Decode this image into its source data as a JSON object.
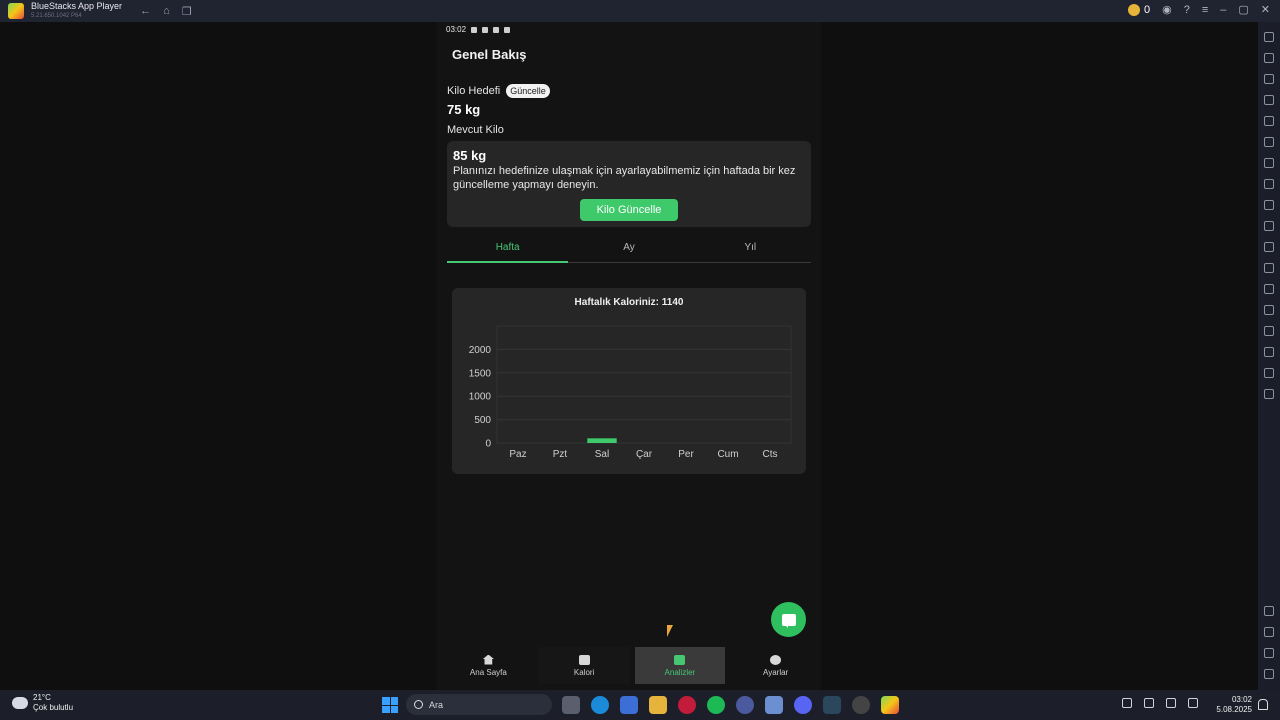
{
  "window": {
    "title": "BlueStacks App Player",
    "version": "5.21.650.1042 P64",
    "coins": "0"
  },
  "statusbar": {
    "time": "03:02"
  },
  "page": {
    "title": "Genel Bakış",
    "goal_label": "Kilo Hedefi",
    "goal_update_button": "Güncelle",
    "goal_value": "75 kg",
    "current_label": "Mevcut Kilo",
    "current_value": "85 kg",
    "hint": "Planınızı hedefinize ulaşmak için ayarlayabilmemiz için haftada bir kez güncelleme yapmayı deneyin.",
    "update_weight_button": "Kilo Güncelle"
  },
  "tabs": [
    {
      "label": "Hafta",
      "active": true
    },
    {
      "label": "Ay",
      "active": false
    },
    {
      "label": "Yıl",
      "active": false
    }
  ],
  "chart_data": {
    "type": "bar",
    "title": "Haftalık Kaloriniz: 1140",
    "categories": [
      "Paz",
      "Pzt",
      "Sal",
      "Çar",
      "Per",
      "Cum",
      "Cts"
    ],
    "values": [
      0,
      0,
      100,
      0,
      0,
      0,
      0
    ],
    "ylim": [
      0,
      2500
    ],
    "yticks": [
      0,
      500,
      1000,
      1500,
      2000
    ],
    "bar_color": "#3ec96b",
    "grid": true
  },
  "bottom_nav": [
    {
      "label": "Ana Sayfa",
      "icon": "home-icon",
      "active": false
    },
    {
      "label": "Kalori",
      "icon": "scan-icon",
      "active": false
    },
    {
      "label": "Analizler",
      "icon": "chart-icon",
      "active": true
    },
    {
      "label": "Ayarlar",
      "icon": "gear-icon",
      "active": false
    }
  ],
  "taskbar": {
    "temperature": "21°C",
    "weather": "Çok bulutlu",
    "search_placeholder": "Ara",
    "time": "03:02",
    "date": "5.08.2025"
  },
  "colors": {
    "accent": "#3ec96b",
    "background": "#131313",
    "card": "#262626"
  }
}
